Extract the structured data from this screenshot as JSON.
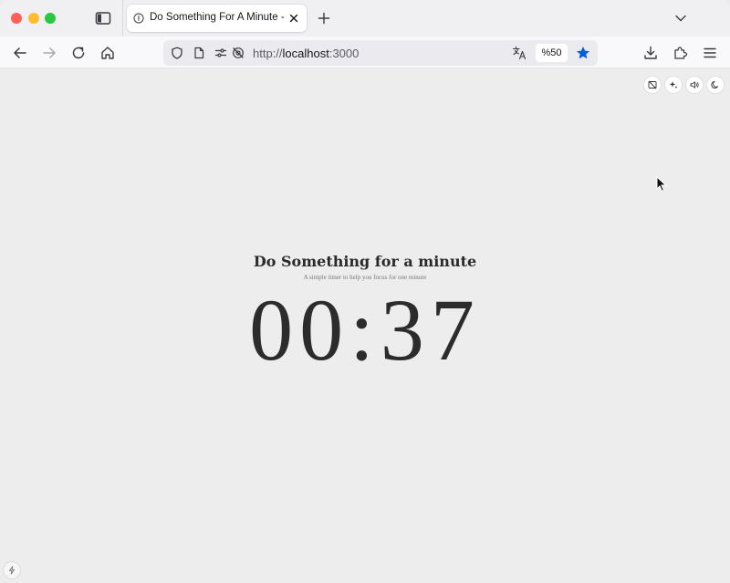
{
  "browser": {
    "tab_title": "Do Something For A Minute - O",
    "url_scheme": "http://",
    "url_host": "localhost",
    "url_port": ":3000",
    "zoom": "%50",
    "icons": {
      "sidebar": "sidebar-icon",
      "tab_favicon": "info-icon",
      "tab_close": "close-icon",
      "new_tab": "plus-icon",
      "tab_list": "chevron-down-icon",
      "back": "back-arrow-icon",
      "forward": "forward-arrow-icon",
      "reload": "reload-icon",
      "home": "home-icon",
      "shield": "shield-icon",
      "page": "page-icon",
      "permissions": "permissions-icon",
      "tracking": "tracking-protection-icon",
      "translate": "translate-icon",
      "bookmark": "star-icon",
      "downloads": "download-icon",
      "extensions": "puzzle-icon",
      "menu": "hamburger-menu-icon"
    },
    "colors": {
      "bookmark_star": "#0060df",
      "close": "#fe5f57",
      "minimize": "#febc2e",
      "zoom": "#28c840"
    }
  },
  "page": {
    "title": "Do Something for a minute",
    "subtitle": "A simple timer to help you focus for one minute",
    "timer": "00:37",
    "controls": [
      "image-off-icon",
      "sparkle-icon",
      "volume-icon",
      "moon-icon"
    ],
    "corner_control": "spark-icon"
  }
}
